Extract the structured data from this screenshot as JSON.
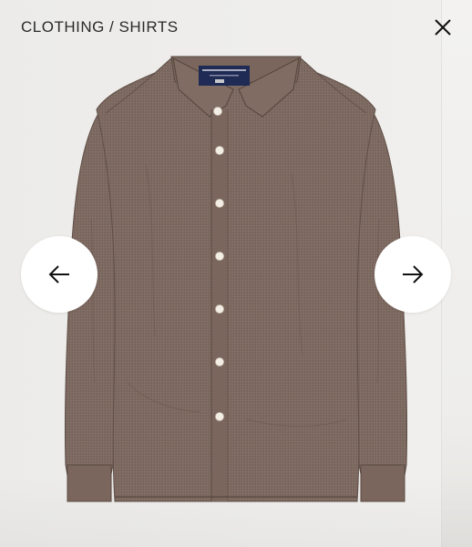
{
  "header": {
    "breadcrumb": "CLOTHING / SHIRTS"
  },
  "icons": {
    "close": "close-icon",
    "prev": "arrow-left-icon",
    "next": "arrow-right-icon"
  },
  "product_image": {
    "subject": "shirt",
    "colors": {
      "fabric": "#7e6a5f",
      "fabric_dark": "#6c5a50",
      "button": "#f4efe6",
      "label": "#1f2a55"
    }
  }
}
